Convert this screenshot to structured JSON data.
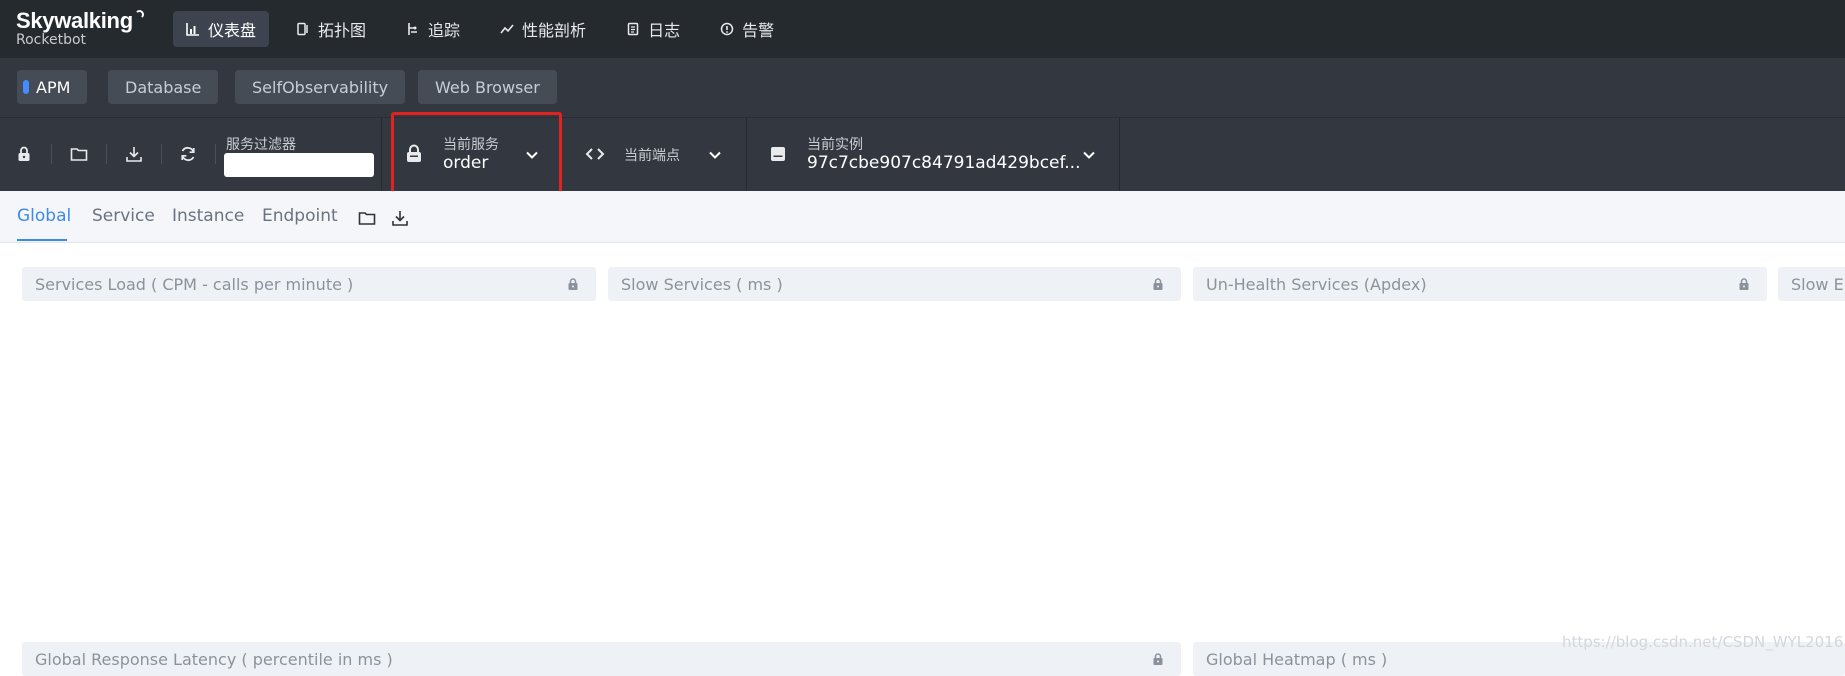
{
  "logo": {
    "name": "Skywalking",
    "sub": "Rocketbot"
  },
  "nav": {
    "items": [
      {
        "label": "仪表盘",
        "icon": "chart-bar-icon",
        "active": true
      },
      {
        "label": "拓扑图",
        "icon": "topology-icon",
        "active": false
      },
      {
        "label": "追踪",
        "icon": "trace-icon",
        "active": false
      },
      {
        "label": "性能剖析",
        "icon": "profile-icon",
        "active": false
      },
      {
        "label": "日志",
        "icon": "log-icon",
        "active": false
      },
      {
        "label": "告警",
        "icon": "alarm-icon",
        "active": false
      }
    ]
  },
  "layers": {
    "items": [
      {
        "label": "APM",
        "active": true
      },
      {
        "label": "Database",
        "active": false
      },
      {
        "label": "SelfObservability",
        "active": false
      },
      {
        "label": "Web Browser",
        "active": false
      }
    ]
  },
  "toolbar": {
    "filter_label": "服务过滤器",
    "filter_value": "",
    "service_label": "当前服务",
    "service_value": "order",
    "endpoint_label": "当前端点",
    "endpoint_value": "",
    "instance_label": "当前实例",
    "instance_value": "97c7cbe907c84791ad429bcef..."
  },
  "tabs": {
    "items": [
      {
        "label": "Global",
        "active": true
      },
      {
        "label": "Service",
        "active": false
      },
      {
        "label": "Instance",
        "active": false
      },
      {
        "label": "Endpoint",
        "active": false
      }
    ]
  },
  "panels": {
    "services_load": "Services Load ( CPM - calls per minute )",
    "slow_services": "Slow Services ( ms )",
    "unhealth_services": "Un-Health Services (Apdex)",
    "slow_endpoints": "Slow En",
    "global_latency": "Global Response Latency ( percentile in ms )",
    "global_heatmap": "Global Heatmap ( ms )"
  },
  "watermark": "https://blog.csdn.net/CSDN_WYL2016",
  "colors": {
    "accent": "#3d8be8",
    "highlight": "#e3211e",
    "topbar": "#252a2f",
    "toolbar": "#333840"
  }
}
